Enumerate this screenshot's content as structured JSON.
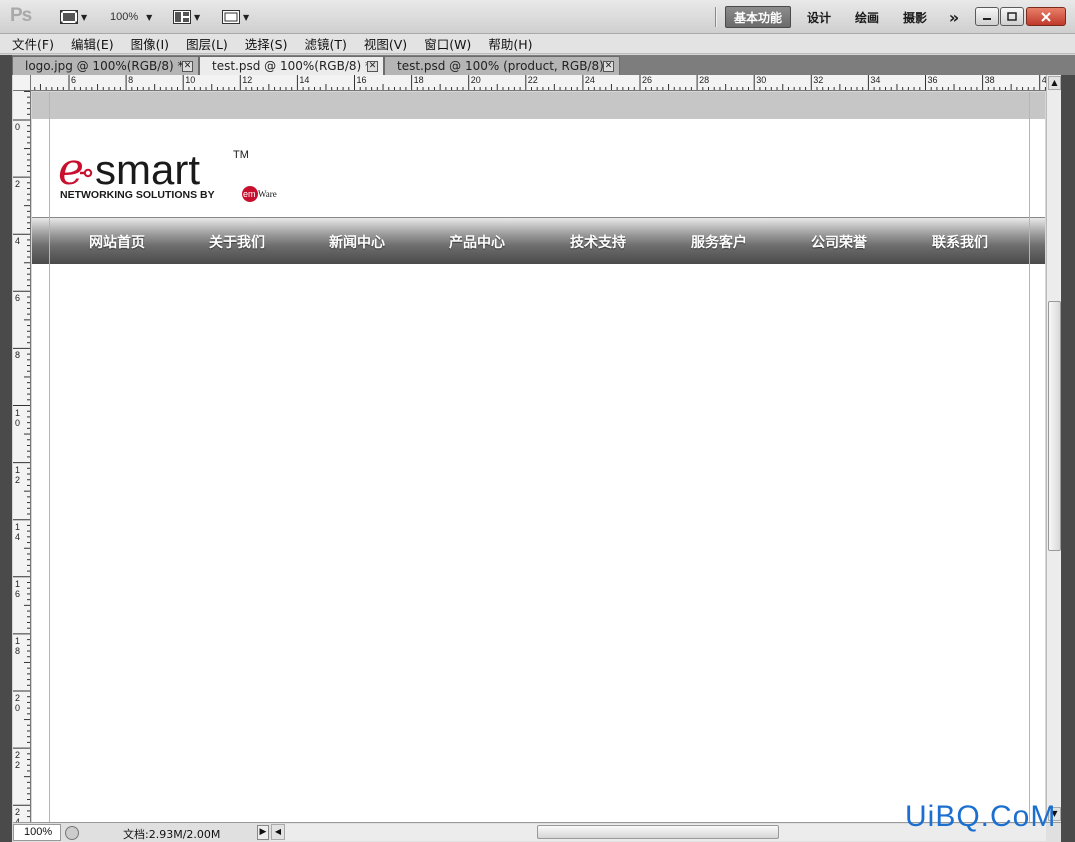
{
  "app": {
    "logo_text": "Ps",
    "zoom_value": "100%"
  },
  "workspace": {
    "items": [
      "基本功能",
      "设计",
      "绘画",
      "摄影"
    ],
    "more": "»"
  },
  "menu": [
    "文件(F)",
    "编辑(E)",
    "图像(I)",
    "图层(L)",
    "选择(S)",
    "滤镜(T)",
    "视图(V)",
    "窗口(W)",
    "帮助(H)"
  ],
  "tabs": [
    {
      "label": "logo.jpg @ 100%(RGB/8) *",
      "active": false
    },
    {
      "label": "test.psd @ 100%(RGB/8) *",
      "active": true
    },
    {
      "label": "test.psd @ 100% (product, RGB/8) *",
      "active": false
    }
  ],
  "ruler": {
    "h_numbers": [
      "6",
      "8",
      "10",
      "12",
      "14",
      "16",
      "18",
      "20",
      "22",
      "24",
      "26",
      "28",
      "30",
      "32",
      "34",
      "36",
      "38",
      "40"
    ],
    "v_numbers": [
      "0",
      "2",
      "4",
      "6",
      "8",
      "10",
      "12",
      "14",
      "16",
      "18",
      "20",
      "22",
      "24"
    ]
  },
  "canvas": {
    "logo": {
      "brand": "e-smart",
      "trademark": "TM",
      "tagline": "NETWORKING SOLUTIONS BY",
      "partner": "emWare"
    },
    "nav": [
      "网站首页",
      "关于我们",
      "新闻中心",
      "产品中心",
      "技术支持",
      "服务客户",
      "公司荣誉",
      "联系我们"
    ]
  },
  "status": {
    "zoom": "100%",
    "doc": "文档:2.93M/2.00M"
  },
  "watermark": "UiBQ.CoM",
  "colors": {
    "accent_red": "#c8102e",
    "guide_cyan": "#5fd7e8",
    "watermark_blue": "#1a6fcf"
  }
}
